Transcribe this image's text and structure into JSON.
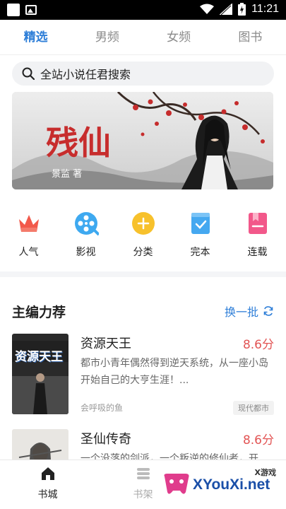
{
  "status_bar": {
    "time": "11:21"
  },
  "tabs": [
    {
      "label": "精选",
      "active": true
    },
    {
      "label": "男频",
      "active": false
    },
    {
      "label": "女频",
      "active": false
    },
    {
      "label": "图书",
      "active": false
    }
  ],
  "search": {
    "placeholder": "全站小说任君搜索"
  },
  "banner": {
    "title": "残仙",
    "author_line": "景监 著"
  },
  "categories": [
    {
      "label": "人气",
      "icon": "crown-icon",
      "color": "#f2594b"
    },
    {
      "label": "影视",
      "icon": "film-reel-icon",
      "color": "#3ea9f0"
    },
    {
      "label": "分类",
      "icon": "plus-circle-icon",
      "color": "#f7c12c"
    },
    {
      "label": "完本",
      "icon": "check-book-icon",
      "color": "#45a8f0"
    },
    {
      "label": "连载",
      "icon": "bookmark-book-icon",
      "color": "#f2588a"
    }
  ],
  "section": {
    "title": "主编力荐",
    "refresh_label": "换一批"
  },
  "books": [
    {
      "title": "资源天王",
      "score": "8.6分",
      "description": "都市小青年偶然得到逆天系统，从一座小岛开始自己的大亨生涯！...",
      "author": "会呼吸的鱼",
      "tag": "现代都市",
      "cover_text": "资源天王"
    },
    {
      "title": "圣仙传奇",
      "score": "8.6分",
      "description": "一个没落的剑派，一个叛逆的修仙者，开",
      "author": "",
      "tag": ""
    }
  ],
  "bottom_nav": [
    {
      "label": "书城",
      "active": true
    },
    {
      "label": "书架",
      "active": false
    }
  ],
  "watermark": {
    "small": "X游戏",
    "big": "XYouXi.net"
  },
  "colors": {
    "accent": "#2f7fd8",
    "score": "#e25454"
  }
}
